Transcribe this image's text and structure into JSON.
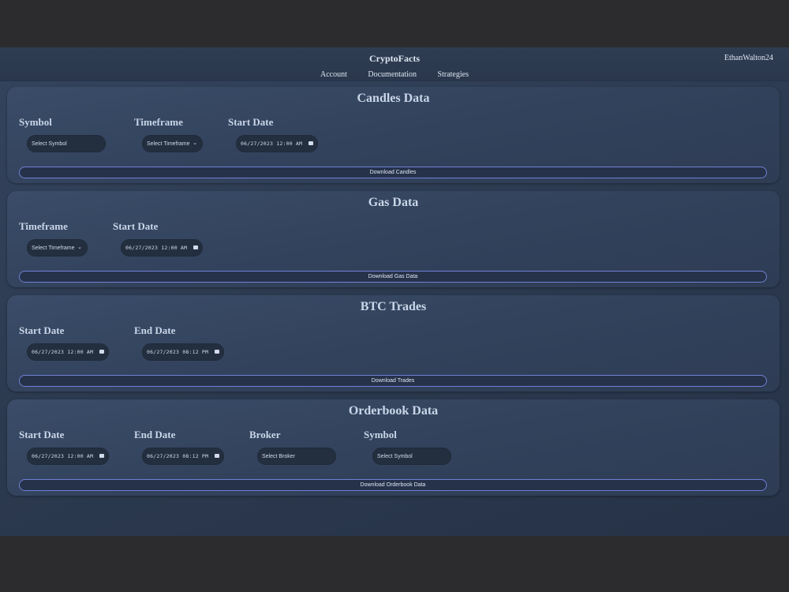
{
  "header": {
    "title": "CryptoFacts",
    "user": "EthanWalton24",
    "nav": [
      "Account",
      "Documentation",
      "Strategies"
    ]
  },
  "candles": {
    "title": "Candles Data",
    "symbol_label": "Symbol",
    "timeframe_label": "Timeframe",
    "start_label": "Start Date",
    "symbol_value": "Select Symbol",
    "timeframe_value": "Select Timeframe",
    "start_value": "06/27/2023 12:00 AM",
    "button": "Download Candles"
  },
  "gas": {
    "title": "Gas Data",
    "timeframe_label": "Timeframe",
    "start_label": "Start Date",
    "timeframe_value": "Select Timeframe",
    "start_value": "06/27/2023 12:00 AM",
    "button": "Download Gas Data"
  },
  "trades": {
    "title": "BTC Trades",
    "start_label": "Start Date",
    "end_label": "End Date",
    "start_value": "06/27/2023 12:00 AM",
    "end_value": "06/27/2023 08:12 PM",
    "button": "Download Trades"
  },
  "orderbook": {
    "title": "Orderbook Data",
    "start_label": "Start Date",
    "end_label": "End Date",
    "broker_label": "Broker",
    "symbol_label": "Symbol",
    "start_value": "06/27/2023 12:00 AM",
    "end_value": "06/27/2023 08:12 PM",
    "broker_value": "Select Broker",
    "symbol_value": "Select Symbol",
    "button": "Download Orderbook Data"
  },
  "colors": {
    "accent": "#6f7fd6",
    "card": "#36475f",
    "input": "#232e3f"
  },
  "icons": {
    "dropdown": "chevron-down-icon",
    "date": "calendar-icon"
  }
}
